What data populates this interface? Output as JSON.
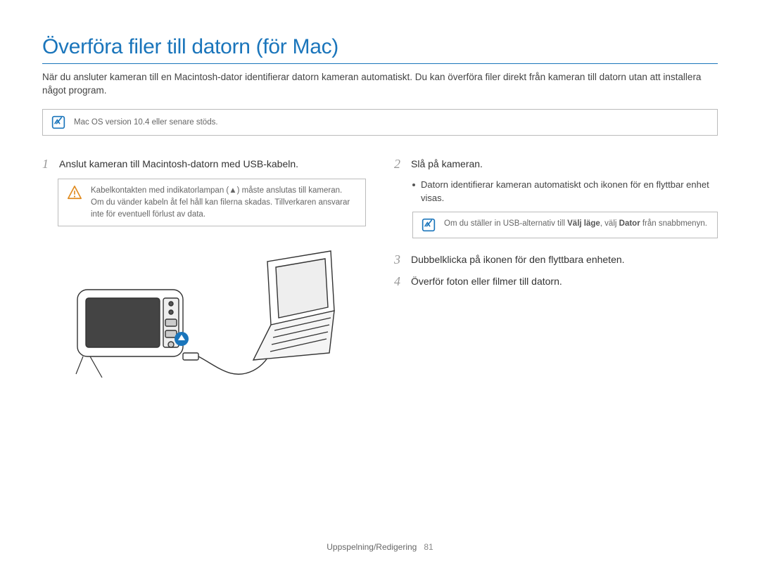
{
  "title": "Överföra filer till datorn (för Mac)",
  "intro": "När du ansluter kameran till en Macintosh-dator identifierar datorn kameran automatiskt. Du kan överföra filer direkt från kameran till datorn utan att installera något program.",
  "top_note": "Mac OS version 10.4 eller senare stöds.",
  "left": {
    "step1_num": "1",
    "step1_text": "Anslut kameran till Macintosh-datorn med USB-kabeln.",
    "warn_text": "Kabelkontakten med indikatorlampan (▲) måste anslutas till kameran. Om du vänder kabeln åt fel håll kan filerna skadas. Tillverkaren ansvarar inte för eventuell förlust av data."
  },
  "right": {
    "step2_num": "2",
    "step2_text": "Slå på kameran.",
    "bullet": "Datorn identifierar kameran automatiskt och ikonen för en flyttbar enhet visas.",
    "note2_pre": "Om du ställer in USB-alternativ till ",
    "note2_b1": "Välj läge",
    "note2_mid": ", välj ",
    "note2_b2": "Dator",
    "note2_post": " från snabbmenyn.",
    "step3_num": "3",
    "step3_text": "Dubbelklicka på ikonen för den flyttbara enheten.",
    "step4_num": "4",
    "step4_text": "Överför foton eller filmer till datorn."
  },
  "footer_section": "Uppspelning/Redigering",
  "footer_page": "81"
}
